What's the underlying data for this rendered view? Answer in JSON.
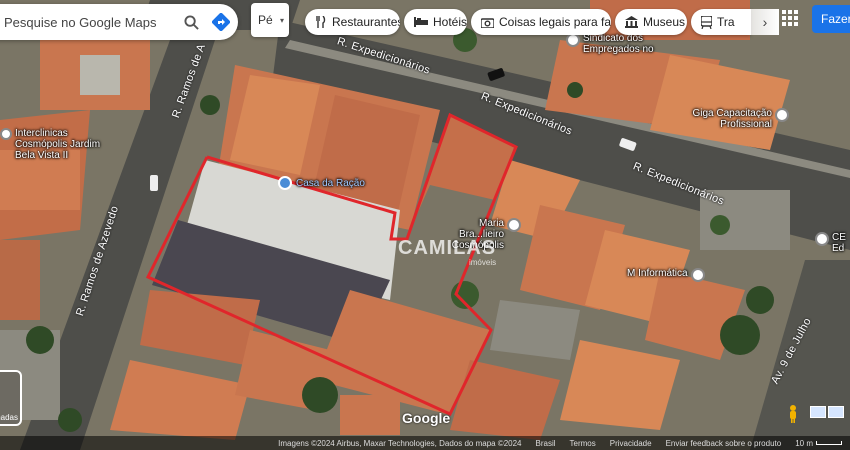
{
  "search": {
    "value": "Pesquise no Google Maps",
    "search_icon": "search-icon",
    "directions_icon": "directions-icon"
  },
  "view_toggle": {
    "label": "Pé"
  },
  "categories": [
    {
      "label": "Restaurantes",
      "icon": "fork-knife-icon"
    },
    {
      "label": "Hotéis",
      "icon": "bed-icon"
    },
    {
      "label": "Coisas legais para fa...",
      "icon": "camera-icon"
    },
    {
      "label": "Museus",
      "icon": "museum-icon"
    },
    {
      "label": "Tra",
      "icon": "transit-icon"
    }
  ],
  "signin_label": "Fazer",
  "streets": {
    "expedicionarios_top": "R. Expedicionários",
    "expedicionarios_mid": "R. Expedicionários",
    "expedicionarios_right": "R. Expedicionários",
    "ramos_top": "R. Ramos de A",
    "ramos_left": "R. Ramos de Azevedo",
    "nove_julho": "Av. 9 de Julho"
  },
  "places": [
    {
      "name": "Sindicato dos Empregados no",
      "icon": "pin-icon"
    },
    {
      "name": "Giga Capacitação Profissional",
      "icon": "pin-icon"
    },
    {
      "name": "Interclinicas Cosmópolis Jardim Bela Vista II",
      "icon": "pin-icon"
    },
    {
      "name": "Casa da Ração",
      "icon": "shop-icon"
    },
    {
      "name": "Maria Bra...lieiro Cosmópolis",
      "icon": "pin-icon"
    },
    {
      "name": "M Informática",
      "icon": "pin-icon"
    },
    {
      "name": "CE Ed",
      "icon": "school-icon"
    }
  ],
  "watermark": {
    "brand": "CAMILAS",
    "sub": "imóveis"
  },
  "google_logo": "Google",
  "layers_label": "Camadas",
  "footer": {
    "imagery": "Imagens ©2024 Airbus, Maxar Technologies, Dados do mapa ©2024",
    "country": "Brasil",
    "terms": "Termos",
    "privacy": "Privacidade",
    "feedback": "Enviar feedback sobre o produto",
    "scale": "10 m"
  },
  "colors": {
    "roof": "#c9764f",
    "road": "#55554f",
    "boundary": "#e0262b",
    "accent": "#1a73e8"
  }
}
